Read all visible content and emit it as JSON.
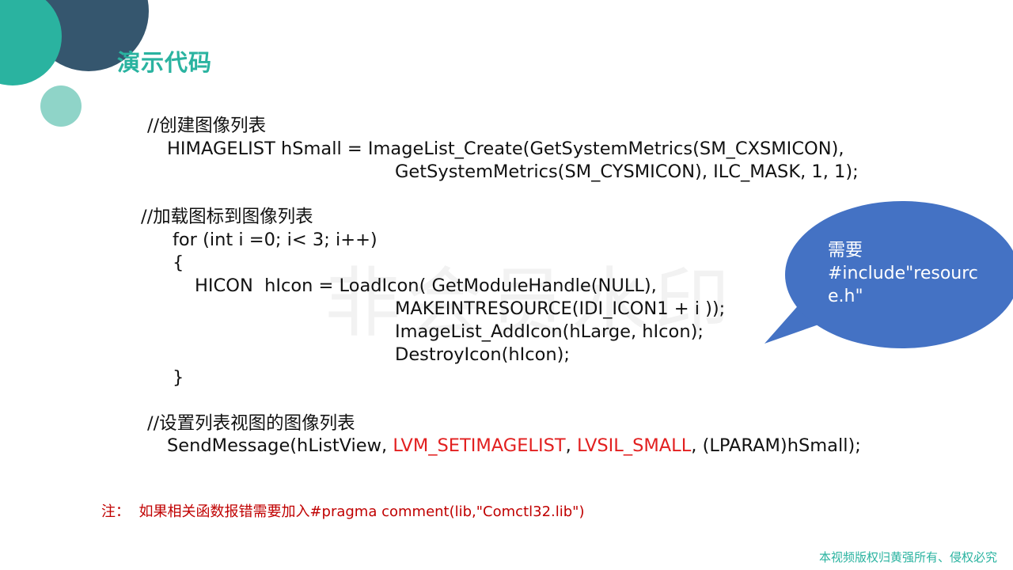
{
  "slide": {
    "title": "演示代码",
    "watermark": "非会员水印",
    "code": {
      "comment1": "//创建图像列表",
      "line1": "HIMAGELIST hSmall = ImageList_Create(GetSystemMetrics(SM_CXSMICON),",
      "line2": "GetSystemMetrics(SM_CYSMICON), ILC_MASK, 1, 1);",
      "comment2": "//加载图标到图像列表",
      "line3": "for (int i =0; i< 3; i++)",
      "line4": "{",
      "line5": "HICON  hIcon = LoadIcon( GetModuleHandle(NULL),",
      "line6": "MAKEINTRESOURCE(IDI_ICON1 + i ));",
      "line7": "ImageList_AddIcon(hLarge, hIcon);",
      "line8": "DestroyIcon(hIcon);",
      "line9": "}",
      "comment3": "//设置列表视图的图像列表",
      "send_prefix": "SendMessage(hListView, ",
      "send_msg": "LVM_SETIMAGELIST",
      "send_sep": ", ",
      "send_flag": "LVSIL_SMALL",
      "send_suffix": ", (LPARAM)hSmall);"
    },
    "note": "注：  如果相关函数报错需要加入#pragma comment(lib,\"Comctl32.lib\")",
    "callout": "需要\n#include\"resourc\ne.h\"",
    "copyright": "本视频版权归黄强所有、侵权必究"
  },
  "colors": {
    "title": "#2ab3a0",
    "accent_red": "#e21f1f",
    "note_red": "#c00000",
    "callout_blue": "#4472c4",
    "deco_dark": "#35566e",
    "deco_teal": "#2ab3a0",
    "deco_light": "#8fd4c8"
  }
}
